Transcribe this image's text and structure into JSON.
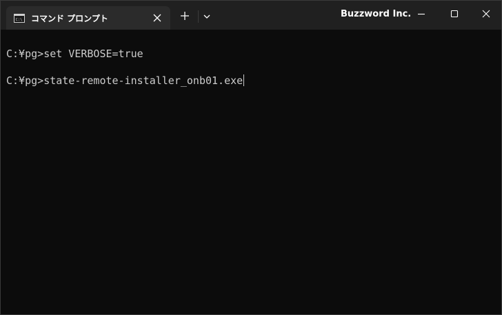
{
  "window": {
    "tab_title": "コマンド プロンプト",
    "app_title": "Buzzword Inc.",
    "colors": {
      "titlebar_bg": "#202020",
      "tab_bg": "#2b2b2b",
      "terminal_bg": "#0c0c0c",
      "terminal_text": "#cccccc"
    }
  },
  "icons": {
    "tab_icon": "cmd-icon",
    "tab_close": "close-icon",
    "new_tab": "plus-icon",
    "dropdown": "chevron-down-icon",
    "minimize": "minimize-icon",
    "maximize": "maximize-icon",
    "close": "close-icon"
  },
  "terminal": {
    "lines": [
      {
        "prompt": "C:¥pg>",
        "command": "set VERBOSE=true"
      },
      {
        "prompt": "C:¥pg>",
        "command": "state-remote-installer_onb01.exe"
      }
    ]
  }
}
